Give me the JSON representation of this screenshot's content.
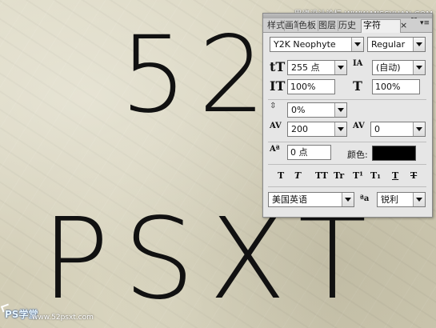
{
  "canvas": {
    "line1": "52",
    "line2": "PSXT"
  },
  "watermark_top": "思缘设计论坛  WWW.MISSYUAN.COM",
  "bottom_logo": {
    "title": "PS学堂",
    "url": "www.52psxt.com"
  },
  "panel": {
    "tabs": [
      "样式",
      "画笔",
      "色板",
      "图层",
      "历史",
      "字符"
    ],
    "active_tab": "字符",
    "close_glyph": "×",
    "font_family": "Y2K Neophyte",
    "font_style": "Regular",
    "font_size": "255 点",
    "leading": "(自动)",
    "vertical_scale": "100%",
    "horizontal_scale": "100%",
    "tsume": "0%",
    "tracking": "200",
    "kerning": "0",
    "baseline_shift": "0 点",
    "color_label": "颜色:",
    "color_value": "#000000",
    "style_buttons": [
      "T",
      "T",
      "TT",
      "Tr",
      "T¹",
      "T₁",
      "T",
      "T"
    ],
    "language": "美国英语",
    "aa_icon": "ªa",
    "antialias": "锐利"
  },
  "icons": {
    "size": "tT",
    "leading": "IA",
    "vscale": "IT",
    "hscale": "T",
    "tracking": "AV",
    "kerning": "AV",
    "baseline": "Aª"
  }
}
